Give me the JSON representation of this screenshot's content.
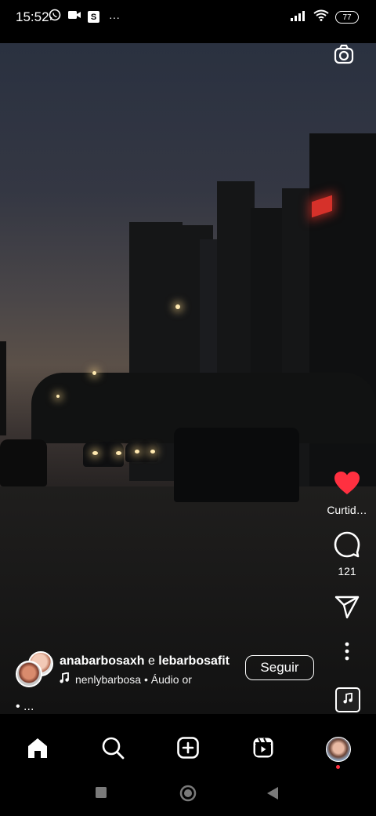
{
  "status_bar": {
    "time": "15:52",
    "left_icons": [
      "whatsapp-icon",
      "video-camera-icon",
      "s-app-icon",
      "more-dots-icon"
    ],
    "s_badge": "S",
    "more": "···",
    "right_icons": [
      "signal-icon",
      "wifi-icon",
      "battery-icon"
    ],
    "battery_level": "77"
  },
  "reel": {
    "camera_icon": "camera-icon",
    "actions": {
      "like_icon": "heart-filled-icon",
      "like_label": "Curtid…",
      "like_color": "#ff3040",
      "comment_icon": "comment-icon",
      "comment_count": "121",
      "share_icon": "send-icon",
      "more_icon": "more-vertical-icon",
      "audio_icon": "music-note-icon"
    },
    "author": {
      "name1": "anabarbosaxh",
      "conjunction": "e",
      "name2": "lebarbosafit",
      "audio_text": "nenlybarbosa • Áudio or"
    },
    "follow_label": "Seguir",
    "caption": "• ..."
  },
  "bottom_nav": {
    "items": [
      "home-icon",
      "search-icon",
      "create-icon",
      "reels-icon",
      "profile-avatar"
    ]
  },
  "system_nav": {
    "items": [
      "recents-icon",
      "home-circle-icon",
      "back-icon"
    ]
  }
}
